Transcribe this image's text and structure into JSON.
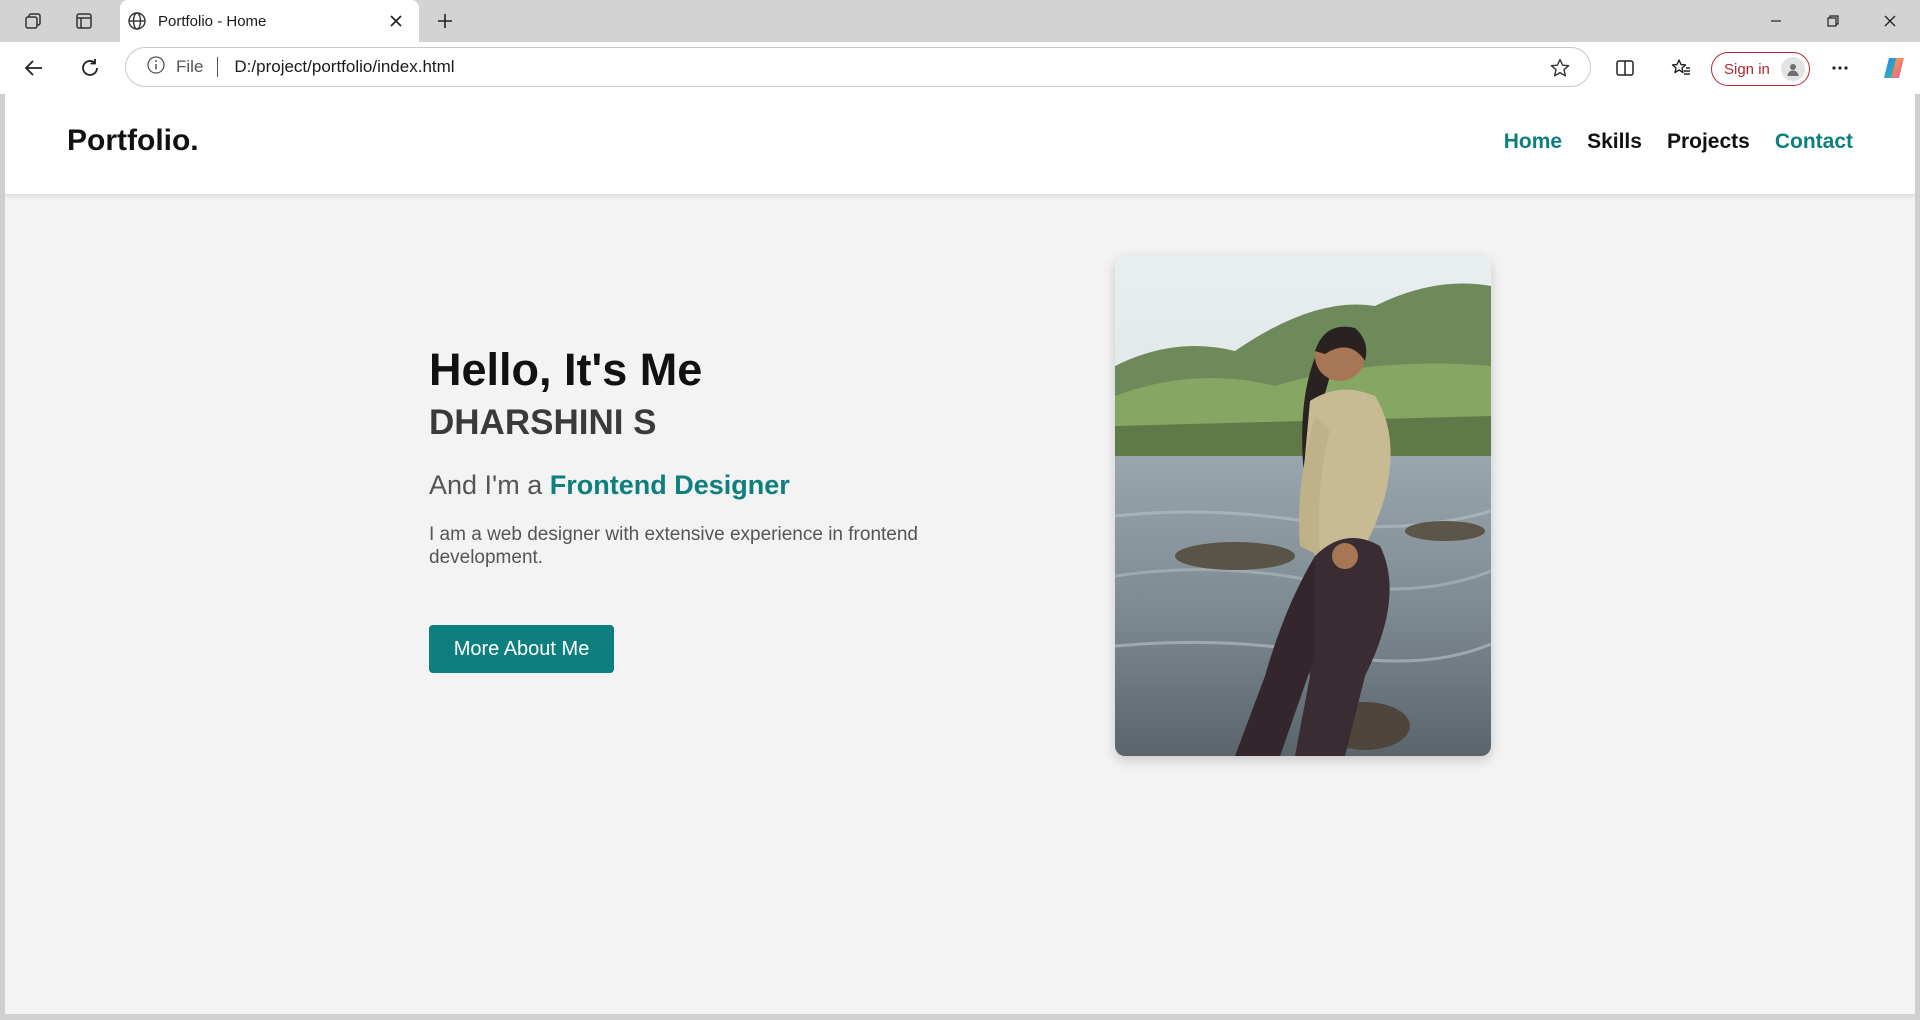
{
  "browser": {
    "tab_title": "Portfolio - Home",
    "address_prefix": "File",
    "url": "D:/project/portfolio/index.html",
    "signin_label": "Sign in"
  },
  "site": {
    "logo": "Portfolio.",
    "nav": [
      {
        "label": "Home",
        "color": "#0d7f7f"
      },
      {
        "label": "Skills",
        "color": "#111111"
      },
      {
        "label": "Projects",
        "color": "#111111"
      },
      {
        "label": "Contact",
        "color": "#0d7f7f"
      }
    ]
  },
  "hero": {
    "greeting": "Hello, It's Me",
    "name": "DHARSHINI S",
    "role_prefix": "And I'm a ",
    "role_highlight": "Frontend Designer",
    "description": "I am a web designer with extensive experience in frontend development.",
    "button_label": "More About Me",
    "accent_color": "#0d7f7f"
  },
  "photo": {
    "icon": "portrait-photo"
  }
}
